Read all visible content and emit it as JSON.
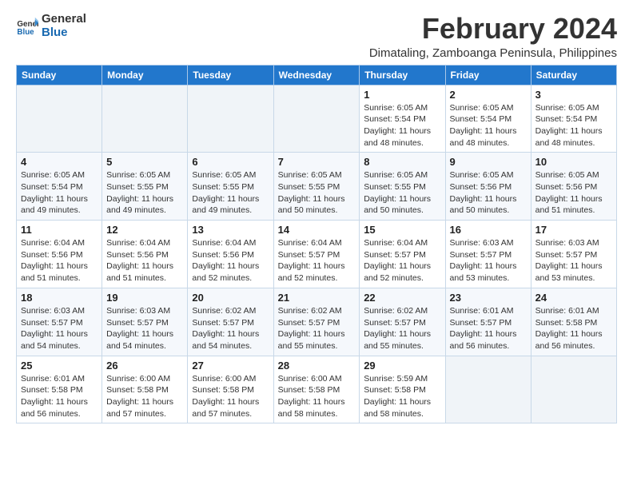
{
  "header": {
    "logo_line1": "General",
    "logo_line2": "Blue",
    "main_title": "February 2024",
    "subtitle": "Dimataling, Zamboanga Peninsula, Philippines"
  },
  "days_of_week": [
    "Sunday",
    "Monday",
    "Tuesday",
    "Wednesday",
    "Thursday",
    "Friday",
    "Saturday"
  ],
  "weeks": [
    [
      {
        "day": "",
        "info": ""
      },
      {
        "day": "",
        "info": ""
      },
      {
        "day": "",
        "info": ""
      },
      {
        "day": "",
        "info": ""
      },
      {
        "day": "1",
        "info": "Sunrise: 6:05 AM\nSunset: 5:54 PM\nDaylight: 11 hours and 48 minutes."
      },
      {
        "day": "2",
        "info": "Sunrise: 6:05 AM\nSunset: 5:54 PM\nDaylight: 11 hours and 48 minutes."
      },
      {
        "day": "3",
        "info": "Sunrise: 6:05 AM\nSunset: 5:54 PM\nDaylight: 11 hours and 48 minutes."
      }
    ],
    [
      {
        "day": "4",
        "info": "Sunrise: 6:05 AM\nSunset: 5:54 PM\nDaylight: 11 hours and 49 minutes."
      },
      {
        "day": "5",
        "info": "Sunrise: 6:05 AM\nSunset: 5:55 PM\nDaylight: 11 hours and 49 minutes."
      },
      {
        "day": "6",
        "info": "Sunrise: 6:05 AM\nSunset: 5:55 PM\nDaylight: 11 hours and 49 minutes."
      },
      {
        "day": "7",
        "info": "Sunrise: 6:05 AM\nSunset: 5:55 PM\nDaylight: 11 hours and 50 minutes."
      },
      {
        "day": "8",
        "info": "Sunrise: 6:05 AM\nSunset: 5:55 PM\nDaylight: 11 hours and 50 minutes."
      },
      {
        "day": "9",
        "info": "Sunrise: 6:05 AM\nSunset: 5:56 PM\nDaylight: 11 hours and 50 minutes."
      },
      {
        "day": "10",
        "info": "Sunrise: 6:05 AM\nSunset: 5:56 PM\nDaylight: 11 hours and 51 minutes."
      }
    ],
    [
      {
        "day": "11",
        "info": "Sunrise: 6:04 AM\nSunset: 5:56 PM\nDaylight: 11 hours and 51 minutes."
      },
      {
        "day": "12",
        "info": "Sunrise: 6:04 AM\nSunset: 5:56 PM\nDaylight: 11 hours and 51 minutes."
      },
      {
        "day": "13",
        "info": "Sunrise: 6:04 AM\nSunset: 5:56 PM\nDaylight: 11 hours and 52 minutes."
      },
      {
        "day": "14",
        "info": "Sunrise: 6:04 AM\nSunset: 5:57 PM\nDaylight: 11 hours and 52 minutes."
      },
      {
        "day": "15",
        "info": "Sunrise: 6:04 AM\nSunset: 5:57 PM\nDaylight: 11 hours and 52 minutes."
      },
      {
        "day": "16",
        "info": "Sunrise: 6:03 AM\nSunset: 5:57 PM\nDaylight: 11 hours and 53 minutes."
      },
      {
        "day": "17",
        "info": "Sunrise: 6:03 AM\nSunset: 5:57 PM\nDaylight: 11 hours and 53 minutes."
      }
    ],
    [
      {
        "day": "18",
        "info": "Sunrise: 6:03 AM\nSunset: 5:57 PM\nDaylight: 11 hours and 54 minutes."
      },
      {
        "day": "19",
        "info": "Sunrise: 6:03 AM\nSunset: 5:57 PM\nDaylight: 11 hours and 54 minutes."
      },
      {
        "day": "20",
        "info": "Sunrise: 6:02 AM\nSunset: 5:57 PM\nDaylight: 11 hours and 54 minutes."
      },
      {
        "day": "21",
        "info": "Sunrise: 6:02 AM\nSunset: 5:57 PM\nDaylight: 11 hours and 55 minutes."
      },
      {
        "day": "22",
        "info": "Sunrise: 6:02 AM\nSunset: 5:57 PM\nDaylight: 11 hours and 55 minutes."
      },
      {
        "day": "23",
        "info": "Sunrise: 6:01 AM\nSunset: 5:57 PM\nDaylight: 11 hours and 56 minutes."
      },
      {
        "day": "24",
        "info": "Sunrise: 6:01 AM\nSunset: 5:58 PM\nDaylight: 11 hours and 56 minutes."
      }
    ],
    [
      {
        "day": "25",
        "info": "Sunrise: 6:01 AM\nSunset: 5:58 PM\nDaylight: 11 hours and 56 minutes."
      },
      {
        "day": "26",
        "info": "Sunrise: 6:00 AM\nSunset: 5:58 PM\nDaylight: 11 hours and 57 minutes."
      },
      {
        "day": "27",
        "info": "Sunrise: 6:00 AM\nSunset: 5:58 PM\nDaylight: 11 hours and 57 minutes."
      },
      {
        "day": "28",
        "info": "Sunrise: 6:00 AM\nSunset: 5:58 PM\nDaylight: 11 hours and 58 minutes."
      },
      {
        "day": "29",
        "info": "Sunrise: 5:59 AM\nSunset: 5:58 PM\nDaylight: 11 hours and 58 minutes."
      },
      {
        "day": "",
        "info": ""
      },
      {
        "day": "",
        "info": ""
      }
    ]
  ]
}
